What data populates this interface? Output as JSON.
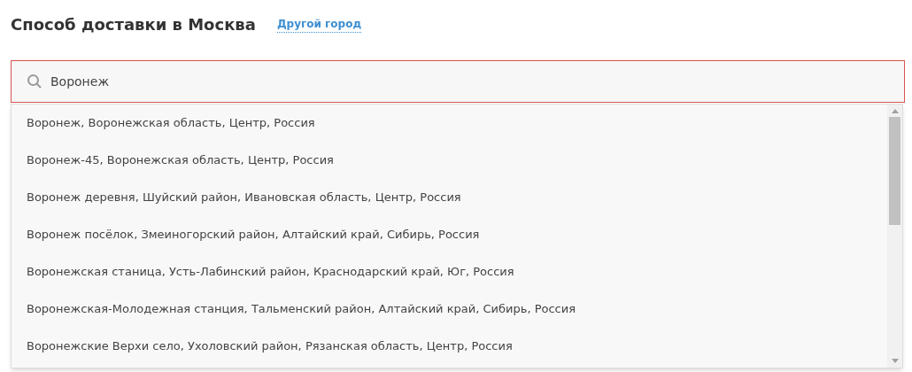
{
  "heading": "Способ доставки в Москва",
  "other_city_link": "Другой город",
  "search": {
    "value": "Воронеж"
  },
  "suggestions": [
    "Воронеж, Воронежская область, Центр, Россия",
    "Воронеж-45, Воронежская область, Центр, Россия",
    "Воронеж деревня, Шуйский район, Ивановская область, Центр, Россия",
    "Воронеж посёлок, Змеиногорский район, Алтайский край, Сибирь, Россия",
    "Воронежская станица, Усть-Лабинский район, Краснодарский край, Юг, Россия",
    "Воронежская-Молодежная станция, Тальменский район, Алтайский край, Сибирь, Россия",
    "Воронежские Верхи село, Ухоловский район, Рязанская область, Центр, Россия"
  ]
}
